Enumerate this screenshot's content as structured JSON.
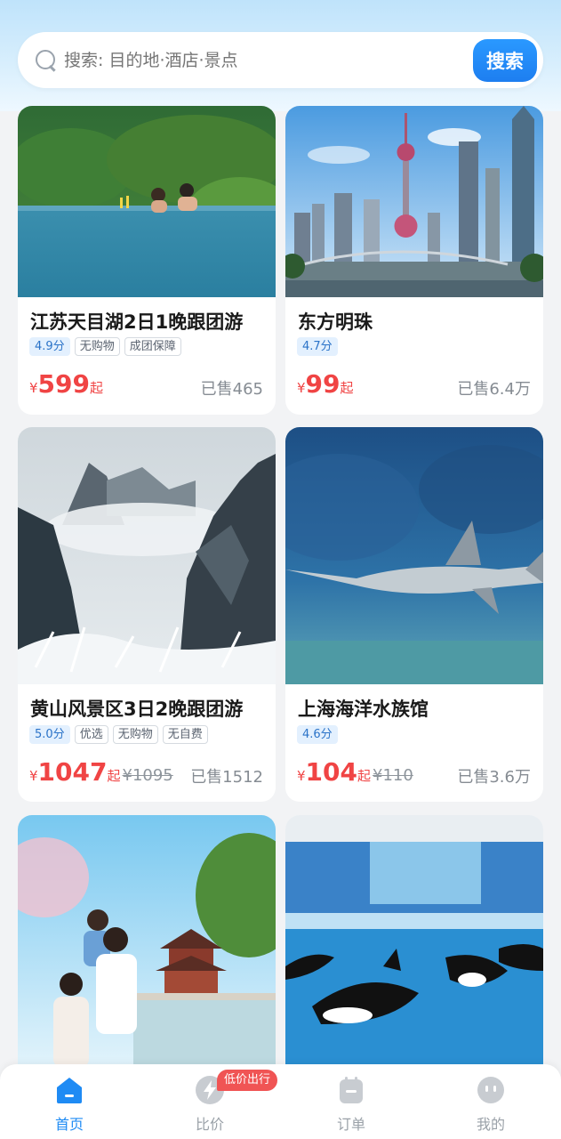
{
  "search": {
    "placeholder": "搜索: 目的地·酒店·景点",
    "button_label": "搜索"
  },
  "cards": [
    {
      "title": "江苏天目湖2日1晚跟团游",
      "tags": [
        "4.9分",
        "无购物",
        "成团保障"
      ],
      "price_symbol": "¥",
      "price": "599",
      "price_unit": "起",
      "original_price": "",
      "sold": "已售465"
    },
    {
      "title": "东方明珠",
      "tags": [
        "4.7分"
      ],
      "price_symbol": "¥",
      "price": "99",
      "price_unit": "起",
      "original_price": "",
      "sold": "已售6.4万"
    },
    {
      "title": "黄山风景区3日2晚跟团游",
      "tags": [
        "5.0分",
        "优选",
        "无购物",
        "无自费"
      ],
      "price_symbol": "¥",
      "price": "1047",
      "price_unit": "起",
      "original_price": "¥1095",
      "sold": "已售1512"
    },
    {
      "title": "上海海洋水族馆",
      "tags": [
        "4.6分"
      ],
      "price_symbol": "¥",
      "price": "104",
      "price_unit": "起",
      "original_price": "¥110",
      "sold": "已售3.6万"
    }
  ],
  "nav": {
    "items": [
      {
        "label": "首页",
        "icon": "home-icon",
        "active": true
      },
      {
        "label": "比价",
        "icon": "lightning-icon",
        "active": false
      },
      {
        "label": "订单",
        "icon": "order-icon",
        "active": false
      },
      {
        "label": "我的",
        "icon": "profile-icon",
        "active": false
      }
    ],
    "badge": "低价出行"
  },
  "colors": {
    "accent": "#1f8bf4",
    "price": "#f04444"
  }
}
